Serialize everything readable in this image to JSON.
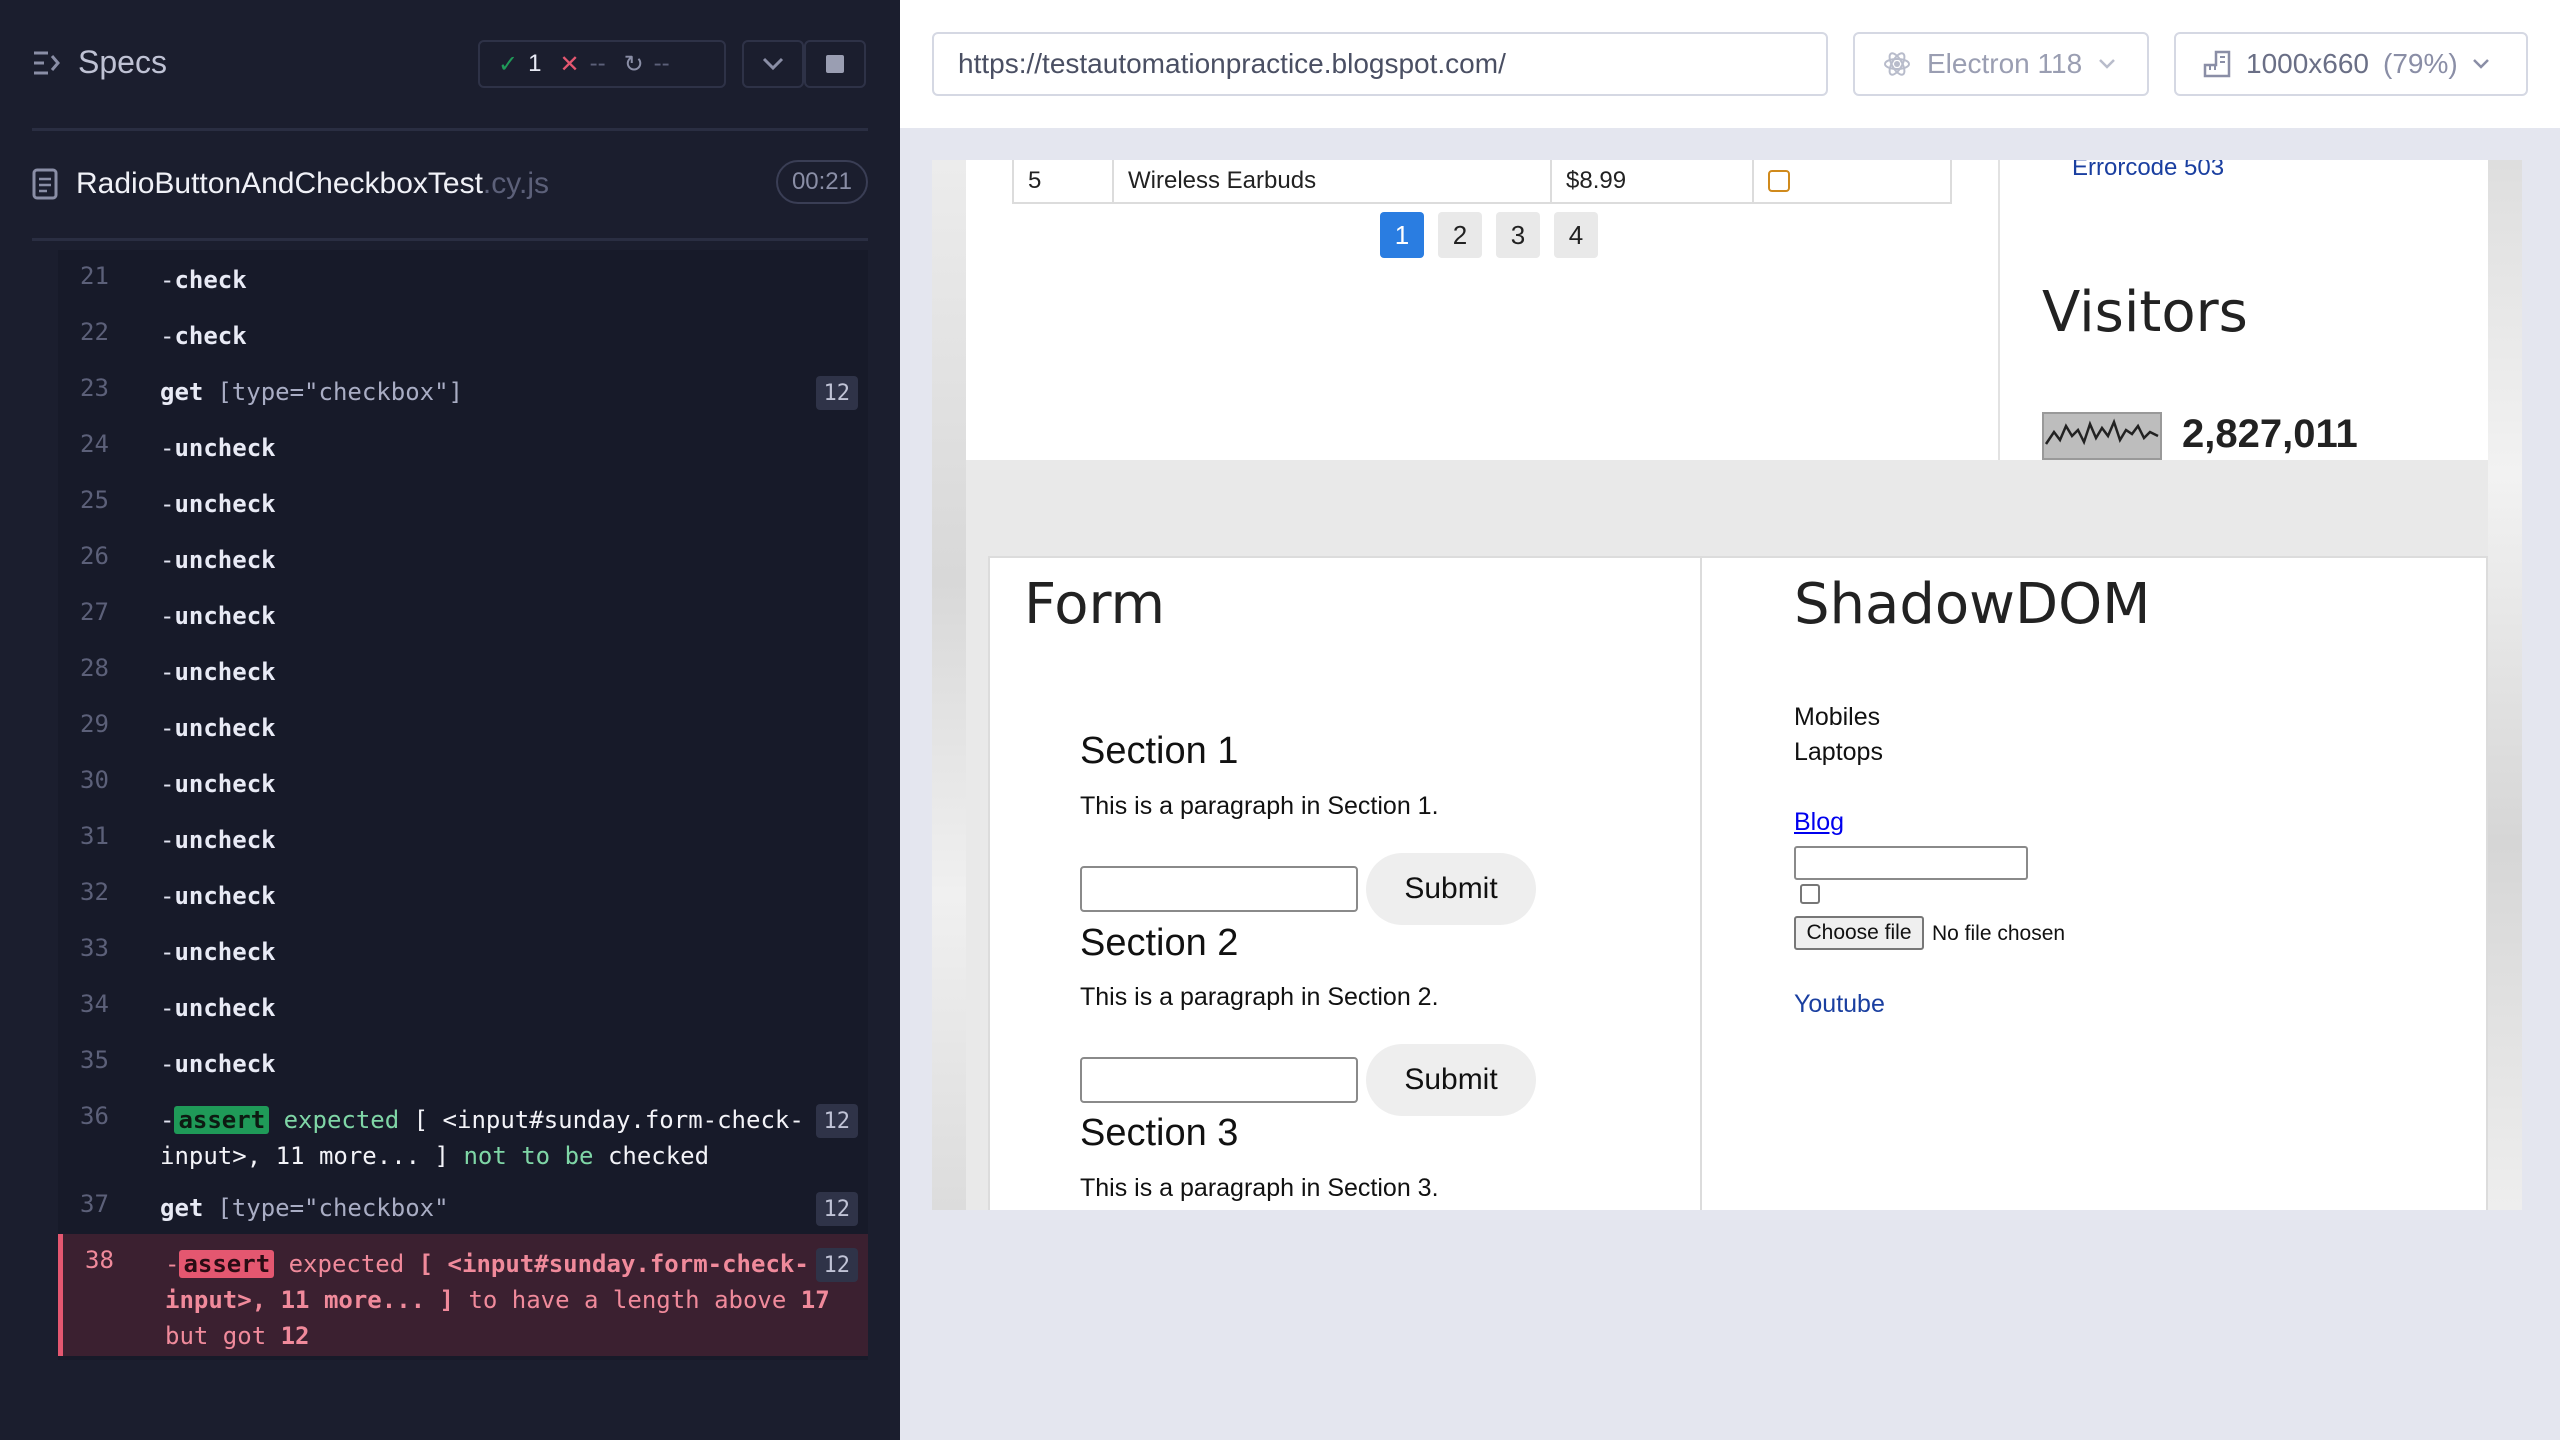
{
  "runner": {
    "specs_label": "Specs",
    "stats": {
      "passed": "1",
      "failed": "--",
      "pending": "--"
    },
    "file": {
      "name": "RadioButtonAndCheckboxTest",
      "ext": ".cy.js",
      "duration": "00:21"
    },
    "commands": [
      {
        "line": "21",
        "prefix": "-",
        "name": "check"
      },
      {
        "line": "22",
        "prefix": "-",
        "name": "check"
      },
      {
        "line": "23",
        "prefix": "",
        "name": "get",
        "selector": "[type=\"checkbox\"]",
        "count": "12"
      },
      {
        "line": "24",
        "prefix": "-",
        "name": "uncheck"
      },
      {
        "line": "25",
        "prefix": "-",
        "name": "uncheck"
      },
      {
        "line": "26",
        "prefix": "-",
        "name": "uncheck"
      },
      {
        "line": "27",
        "prefix": "-",
        "name": "uncheck"
      },
      {
        "line": "28",
        "prefix": "-",
        "name": "uncheck"
      },
      {
        "line": "29",
        "prefix": "-",
        "name": "uncheck"
      },
      {
        "line": "30",
        "prefix": "-",
        "name": "uncheck"
      },
      {
        "line": "31",
        "prefix": "-",
        "name": "uncheck"
      },
      {
        "line": "32",
        "prefix": "-",
        "name": "uncheck"
      },
      {
        "line": "33",
        "prefix": "-",
        "name": "uncheck"
      },
      {
        "line": "34",
        "prefix": "-",
        "name": "uncheck"
      },
      {
        "line": "35",
        "prefix": "-",
        "name": "uncheck"
      }
    ],
    "cmd36": {
      "line": "36",
      "tag": "assert",
      "w1": "expected",
      "target": "[ <input#sunday.form-check-input>, 11 more... ]",
      "w2": "not to be",
      "w3": "checked",
      "count": "12"
    },
    "cmd37": {
      "line": "37",
      "name": "get",
      "selector": "[type=\"checkbox\"",
      "count": "12"
    },
    "cmd38": {
      "line": "38",
      "tag": "assert",
      "w1": "expected",
      "target": "[ <input#sunday.form-check-input>, 11 more... ]",
      "w2": "to have a length above",
      "n1": "17",
      "w3": "but got",
      "n2": "12",
      "count": "12"
    }
  },
  "browser": {
    "url": "https://testautomationpractice.blogspot.com/",
    "engine": "Electron 118",
    "viewport": "1000x660",
    "zoom": "(79%)"
  },
  "aut": {
    "table_row": {
      "id": "5",
      "product": "Wireless Earbuds",
      "price": "$8.99"
    },
    "pages": [
      "1",
      "2",
      "3",
      "4"
    ],
    "error_link": "Errorcode 503",
    "visitors": {
      "title": "Visitors",
      "count": "2,827,011"
    },
    "form": {
      "title": "Form",
      "sections": [
        {
          "heading": "Section 1",
          "para": "This is a paragraph in Section 1.",
          "button": "Submit"
        },
        {
          "heading": "Section 2",
          "para": "This is a paragraph in Section 2.",
          "button": "Submit"
        },
        {
          "heading": "Section 3",
          "para": "This is a paragraph in Section 3."
        }
      ]
    },
    "shadow": {
      "title": "ShadowDOM",
      "items": [
        "Mobiles",
        "Laptops"
      ],
      "blog": "Blog",
      "choose_file": "Choose file",
      "no_file": "No file chosen",
      "youtube": "Youtube"
    }
  },
  "colors": {
    "pass": "#1f9a58",
    "fail": "#e45770",
    "accent": "#2a7de1"
  }
}
